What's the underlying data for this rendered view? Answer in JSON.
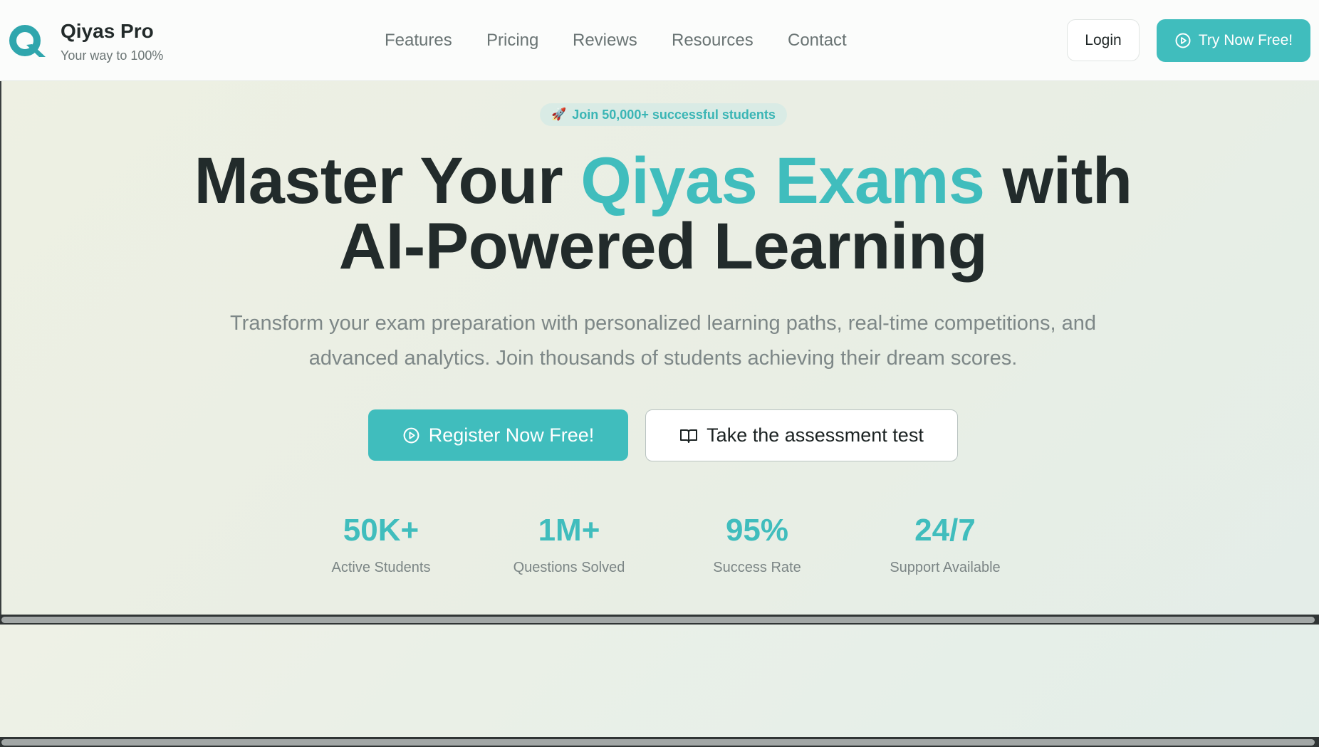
{
  "brand": {
    "name": "Qiyas Pro",
    "tagline": "Your way to 100%"
  },
  "nav": {
    "items": [
      {
        "label": "Features"
      },
      {
        "label": "Pricing"
      },
      {
        "label": "Reviews"
      },
      {
        "label": "Resources"
      },
      {
        "label": "Contact"
      }
    ],
    "login_label": "Login",
    "try_label": "Try Now Free!"
  },
  "hero": {
    "badge_icon": "rocket-icon",
    "badge": "Join 50,000+ successful students",
    "title_part1": "Master Your ",
    "title_accent": "Qiyas Exams",
    "title_part2": " with",
    "title_line2": "AI-Powered Learning",
    "subtitle_line1": "Transform your exam preparation with personalized learning paths, real-time competitions, and",
    "subtitle_line2": "advanced analytics. Join thousands of students achieving their dream scores.",
    "register_label": "Register Now Free!",
    "assessment_label": "Take the assessment test"
  },
  "stats": [
    {
      "value": "50K+",
      "label": "Active Students"
    },
    {
      "value": "1M+",
      "label": "Questions Solved"
    },
    {
      "value": "95%",
      "label": "Success Rate"
    },
    {
      "value": "24/7",
      "label": "Support Available"
    }
  ],
  "colors": {
    "accent": "#40bdbd",
    "dark_text": "#222b2b",
    "muted_text": "#7d8787"
  }
}
